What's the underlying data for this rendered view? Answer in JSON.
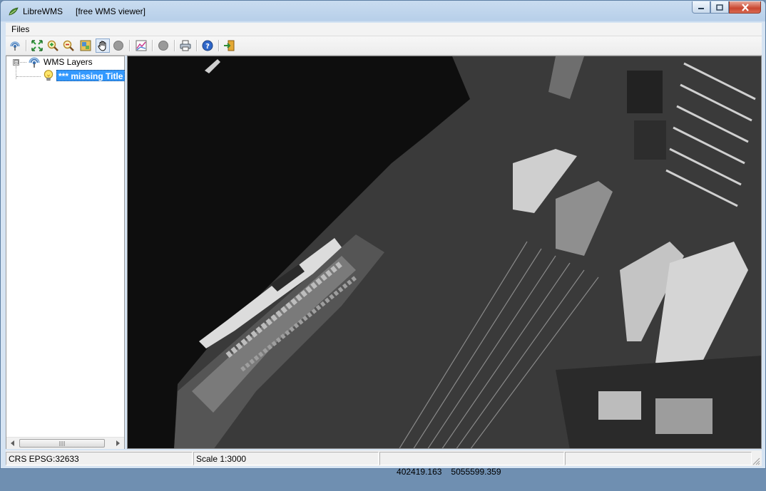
{
  "window": {
    "app_name": "LibreWMS",
    "subtitle": "[free WMS viewer]"
  },
  "menu": {
    "files": "Files"
  },
  "toolbar": {
    "buttons": [
      "wms-connect-icon",
      "zoom-full-icon",
      "zoom-in-icon",
      "zoom-out-icon",
      "zoom-layer-icon",
      "pan-hand-icon",
      "identify-icon",
      "legend-icon",
      "stop-icon",
      "print-icon",
      "help-icon",
      "exit-icon"
    ],
    "active": "pan-hand-icon"
  },
  "layer_tree": {
    "root_label": "WMS Layers",
    "layer_label": "*** missing Title",
    "expander": "⊟"
  },
  "status": {
    "crs": "CRS EPSG:32633",
    "scale": "Scale 1:3000",
    "coord_x": "402419.163",
    "coord_y": "5055599.359"
  },
  "colors": {
    "selection": "#3399ff",
    "map_background": "#0d0d0d"
  }
}
